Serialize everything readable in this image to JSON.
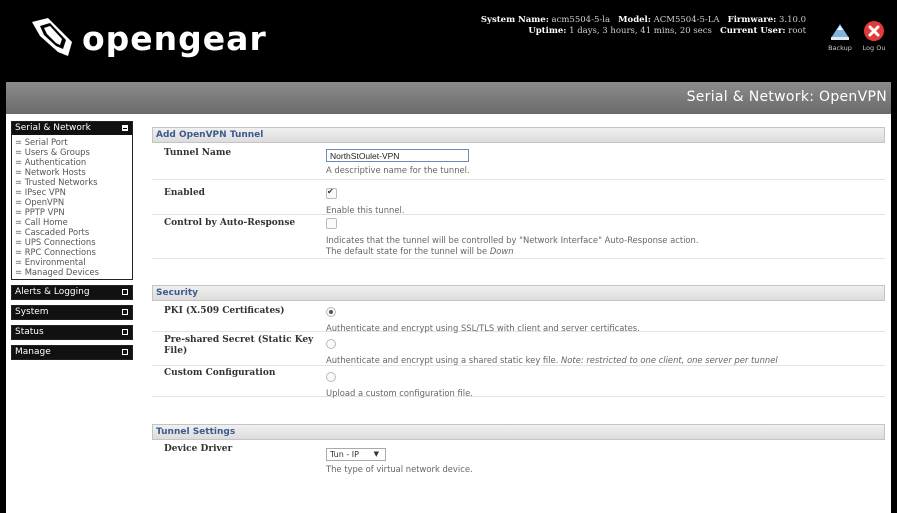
{
  "brand": {
    "name": "opengear"
  },
  "system": {
    "name_label": "System Name:",
    "name_value": "acm5504-5-la",
    "model_label": "Model:",
    "model_value": "ACM5504-5-LA",
    "firmware_label": "Firmware:",
    "firmware_value": "3.10.0",
    "uptime_label": "Uptime:",
    "uptime_value": "1 days, 3 hours, 41 mins, 20 secs",
    "user_label": "Current User:",
    "user_value": "root"
  },
  "header_actions": {
    "backup_label": "Backup",
    "logout_label": "Log Ou"
  },
  "page": {
    "heading": "Serial & Network: OpenVPN"
  },
  "sidebar": {
    "serial_network": {
      "title": "Serial & Network",
      "items": [
        "Serial Port",
        "Users & Groups",
        "Authentication",
        "Network Hosts",
        "Trusted Networks",
        "IPsec VPN",
        "OpenVPN",
        "PPTP VPN",
        "Call Home",
        "Cascaded Ports",
        "UPS Connections",
        "RPC Connections",
        "Environmental",
        "Managed Devices"
      ]
    },
    "alerts": {
      "title": "Alerts & Logging"
    },
    "system": {
      "title": "System"
    },
    "status": {
      "title": "Status"
    },
    "manage": {
      "title": "Manage"
    }
  },
  "sections": {
    "add_tunnel": {
      "title": "Add OpenVPN Tunnel",
      "tunnel_name": {
        "label": "Tunnel Name",
        "value": "NorthStOulet-VPN",
        "hint": "A descriptive name for the tunnel."
      },
      "enabled": {
        "label": "Enabled",
        "checked": true,
        "hint": "Enable this tunnel."
      },
      "auto_response": {
        "label": "Control by Auto-Response",
        "checked": false,
        "hint_line1": "Indicates that the tunnel will be controlled by \"Network Interface\" Auto-Response action.",
        "hint_line2_prefix": "The default state for the tunnel will be ",
        "hint_line2_em": "Down"
      }
    },
    "security": {
      "title": "Security",
      "pki": {
        "label": "PKI (X.509 Certificates)",
        "selected": true,
        "hint": "Authenticate and encrypt using SSL/TLS with client and server certificates."
      },
      "psk": {
        "label": "Pre-shared Secret (Static Key File)",
        "selected": false,
        "hint_prefix": "Authenticate and encrypt using a shared static key file. ",
        "hint_note": "Note: restricted to one client, one server per tunnel"
      },
      "custom": {
        "label": "Custom Configuration",
        "selected": false,
        "hint": "Upload a custom configuration file."
      }
    },
    "tunnel_settings": {
      "title": "Tunnel Settings",
      "device_driver": {
        "label": "Device Driver",
        "value": "Tun - IP",
        "hint": "The type of virtual network device."
      }
    }
  },
  "colors": {
    "section_title": "#3d5b8c",
    "backup_icon": "#7fb3e0",
    "logout_icon": "#e03a3a"
  }
}
